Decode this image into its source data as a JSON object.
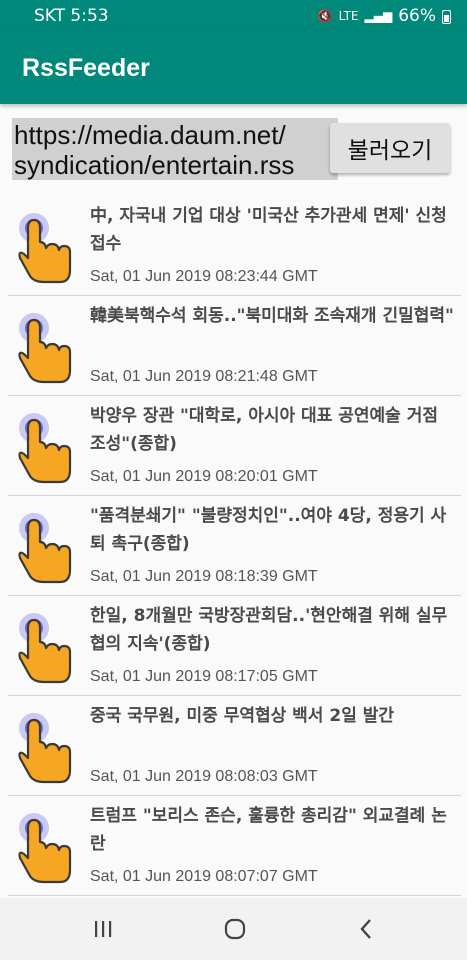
{
  "status_bar": {
    "time": "SKT 5:53",
    "signal": "LTE",
    "battery": "66%"
  },
  "app_bar": {
    "title": "RssFeeder"
  },
  "url_input": {
    "value": "https://media.daum.net/\nsyndication/entertain.rss"
  },
  "load_button": {
    "label": "불러오기"
  },
  "feed": {
    "items": [
      {
        "title": "中, 자국내 기업 대상 '미국산 추가관세 면제' 신청접수",
        "date": "Sat, 01 Jun 2019 08:23:44 GMT"
      },
      {
        "title": "韓美북핵수석 회동..\"북미대화 조속재개 긴밀협력\"",
        "date": "Sat, 01 Jun 2019 08:21:48 GMT"
      },
      {
        "title": "박양우 장관 \"대학로, 아시아 대표 공연예술 거점 조성\"(종합)",
        "date": "Sat, 01 Jun 2019 08:20:01 GMT"
      },
      {
        "title": "\"품격분쇄기\" \"불량정치인\"..여야 4당, 정용기 사퇴 촉구(종합)",
        "date": "Sat, 01 Jun 2019 08:18:39 GMT"
      },
      {
        "title": "한일, 8개월만 국방장관회담..'현안해결 위해 실무협의 지속'(종합)",
        "date": "Sat, 01 Jun 2019 08:17:05 GMT"
      },
      {
        "title": "중국 국무원, 미중 무역협상 백서 2일 발간",
        "date": "Sat, 01 Jun 2019 08:08:03 GMT"
      },
      {
        "title": "트럼프 \"보리스 존슨, 훌륭한 총리감\" 외교결례 논란",
        "date": "Sat, 01 Jun 2019 08:07:07 GMT"
      }
    ]
  },
  "nav_bar": {
    "recents_icon": "recents-icon",
    "home_icon": "home-icon",
    "back_icon": "back-icon"
  },
  "colors": {
    "primary": "#00897b",
    "url_field_bg": "#d0d0d0",
    "icon_orange": "#f5a623",
    "icon_ring": "#6b6be0"
  }
}
